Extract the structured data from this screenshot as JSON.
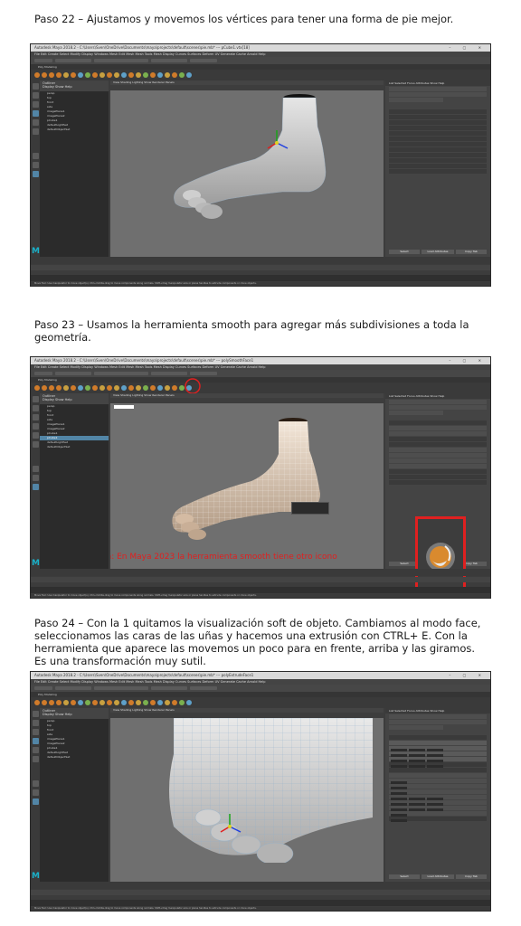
{
  "steps": [
    {
      "title": "Paso 22 – Ajustamos y movemos los vértices para tener una forma de pie mejor.",
      "window_title": "Autodesk Maya 2018.2 - C:\\Users\\Sven\\OneDrive\\Documents\\maya\\projects\\default\\scenes\\pie.mb*  ---  pCube1.vtx[18]"
    },
    {
      "title": "Paso 23 – Usamos la herramienta smooth para agregar más subdivisiones a toda la geometría.",
      "window_title": "Autodesk Maya 2018.2 - C:\\Users\\Sven\\OneDrive\\Documents\\maya\\projects\\default\\scenes\\pie.mb*  ---  polySmoothFace1",
      "observation": "Observación: En Maya 2023 la herramienta smooth tiene otro icono"
    },
    {
      "title": "Paso 24 – Con la 1 quitamos la visualización soft de objeto. Cambiamos al modo face, seleccionamos las caras de las uñas y hacemos una extrusión con CTRL+ E. Con la herramienta que aparece las movemos un poco para en frente, arriba y las giramos. Es una transformación muy sutil.",
      "window_title": "Autodesk Maya 2018.2 - C:\\Users\\Sven\\OneDrive\\Documents\\maya\\projects\\default\\scenes\\pie.mb*  ---  polyExtrudeFace1"
    }
  ],
  "ui": {
    "menus": "File  Edit  Create  Select  Modify  Display  Windows  Mesh  Edit Mesh  Mesh Tools  Mesh Display  Curves  Surfaces  Deform  UV  Generate  Cache  Arnold  Help",
    "shelf_tab": "Poly Modeling",
    "outliner_title": "Outliner",
    "outliner_menu": "Display  Show  Help",
    "viewport_menu": "View  Shading  Lighting  Show  Renderer  Panels",
    "attr_tabs": "List  Selected  Focus  Attributes  Show  Help",
    "select_btn": "Select",
    "load_attr_btn": "Load Attributes",
    "copy_tab_btn": "Copy Tab",
    "no_char_set": "No Character Set",
    "no_anim_layer": "No Anim Layer",
    "fps": "24 fps",
    "outliner_items": [
      "persp",
      "top",
      "front",
      "side",
      "imagePlane1",
      "imagePlane2",
      "pCube1",
      "defaultLightSet",
      "defaultObjectSet"
    ],
    "outliner_items_s23": [
      "persp",
      "top",
      "front",
      "side",
      "imagePlane1",
      "imagePlane2",
      "pCube1",
      "pCube1",
      "defaultLightSet",
      "defaultObjectSet"
    ],
    "help_line": "Move Tool: Use manipulator to move object(s). Ctrl+middle-drag to move components along normals. Shift+drag manipulator axis or plane handles to extrude components or clone objects."
  }
}
